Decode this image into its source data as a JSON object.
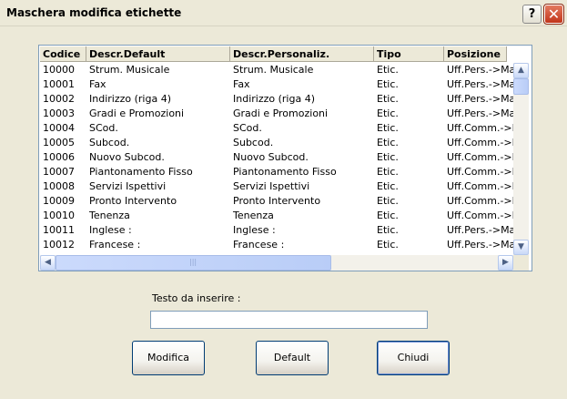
{
  "window": {
    "title": "Maschera modifica etichette",
    "help_glyph": "?",
    "close_glyph": "✕"
  },
  "table": {
    "columns": [
      "Codice",
      "Descr.Default",
      "Descr.Personaliz.",
      "Tipo",
      "Posizione"
    ],
    "rows": [
      [
        "10000",
        "Strum. Musicale",
        "Strum. Musicale",
        "Etic.",
        "Uff.Pers.->Masc"
      ],
      [
        "10001",
        "Fax",
        "Fax",
        "Etic.",
        "Uff.Pers.->Masc"
      ],
      [
        "10002",
        "Indirizzo (riga 4)",
        "Indirizzo (riga 4)",
        "Etic.",
        "Uff.Pers.->Masc"
      ],
      [
        "10003",
        "Gradi e Promozioni",
        "Gradi e Promozioni",
        "Etic.",
        "Uff.Pers.->Masc"
      ],
      [
        "10004",
        "SCod.",
        "SCod.",
        "Etic.",
        "Uff.Comm.->Ma"
      ],
      [
        "10005",
        "Subcod.",
        "Subcod.",
        "Etic.",
        "Uff.Comm.->Ma"
      ],
      [
        "10006",
        "Nuovo Subcod.",
        "Nuovo Subcod.",
        "Etic.",
        "Uff.Comm.->Ma"
      ],
      [
        "10007",
        "Piantonamento Fisso",
        "Piantonamento Fisso",
        "Etic.",
        "Uff.Comm.->Ma"
      ],
      [
        "10008",
        "Servizi Ispettivi",
        "Servizi Ispettivi",
        "Etic.",
        "Uff.Comm.->Ma"
      ],
      [
        "10009",
        "Pronto Intervento",
        "Pronto Intervento",
        "Etic.",
        "Uff.Comm.->Ma"
      ],
      [
        "10010",
        "Tenenza",
        "Tenenza",
        "Etic.",
        "Uff.Comm.->Ma"
      ],
      [
        "10011",
        "Inglese :",
        "Inglese :",
        "Etic.",
        "Uff.Pers.->Masc"
      ],
      [
        "10012",
        "Francese :",
        "Francese :",
        "Etic.",
        "Uff.Pers.->Masc"
      ]
    ]
  },
  "scrollbar": {
    "up": "▲",
    "down": "▼",
    "left": "◀",
    "right": "▶",
    "grip": "|||"
  },
  "form": {
    "label": "Testo da inserire :",
    "value": ""
  },
  "buttons": {
    "modify": "Modifica",
    "default": "Default",
    "close": "Chiudi"
  }
}
